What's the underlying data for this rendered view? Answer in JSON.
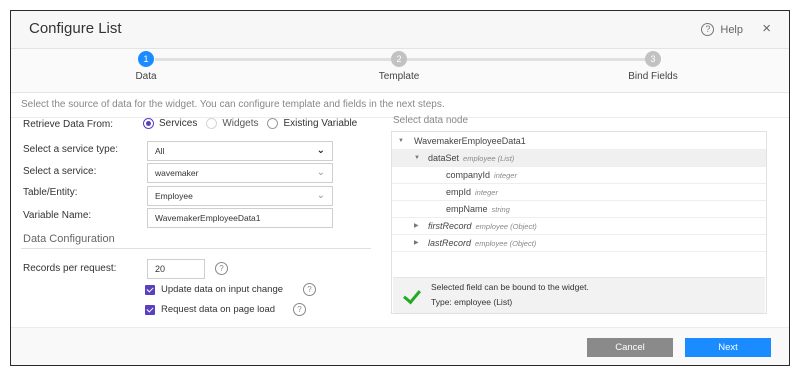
{
  "dialog": {
    "title": "Configure List",
    "help_label": "Help",
    "help_glyph": "?",
    "close_glyph": "×"
  },
  "steps": [
    {
      "number": "1",
      "label": "Data",
      "active": true
    },
    {
      "number": "2",
      "label": "Template",
      "active": false
    },
    {
      "number": "3",
      "label": "Bind Fields",
      "active": false
    }
  ],
  "info_text": "Select the source of data for the widget. You can configure template and fields in the next steps.",
  "form": {
    "retrieve_label": "Retrieve Data From:",
    "retrieve_options": [
      {
        "label": "Services",
        "selected": true
      },
      {
        "label": "Widgets",
        "selected": false
      },
      {
        "label": "Existing Variable",
        "selected": false
      }
    ],
    "service_type_label": "Select a service type:",
    "service_type_value": "All",
    "service_label": "Select a service:",
    "service_value": "wavemaker",
    "entity_label": "Table/Entity:",
    "entity_value": "Employee",
    "variable_label": "Variable Name:",
    "variable_value": "WavemakerEmployeeData1"
  },
  "data_config": {
    "section_title": "Data Configuration",
    "records_label": "Records per request:",
    "records_value": "20",
    "update_label": "Update data on input change",
    "update_checked": true,
    "request_label": "Request data on page load",
    "request_checked": true
  },
  "data_node": {
    "title": "Select data node",
    "nodes": [
      {
        "name": "WavemakerEmployeeData1",
        "type": "",
        "arrow": "▼"
      },
      {
        "name": "dataSet",
        "type": "employee (List)",
        "arrow": "▼"
      },
      {
        "name": "companyId",
        "type": "integer",
        "arrow": ""
      },
      {
        "name": "empId",
        "type": "integer",
        "arrow": ""
      },
      {
        "name": "empName",
        "type": "string",
        "arrow": ""
      },
      {
        "name": "firstRecord",
        "type": "employee (Object)",
        "arrow": "▶"
      },
      {
        "name": "lastRecord",
        "type": "employee (Object)",
        "arrow": "▶"
      }
    ],
    "message_line1": "Selected field can be bound to the widget.",
    "message_line2": "Type: employee (List)"
  },
  "footer": {
    "cancel_label": "Cancel",
    "next_label": "Next"
  },
  "colors": {
    "accent": "#1a8cff",
    "radio_check": "#5a3fc0",
    "success": "#22aa22"
  }
}
